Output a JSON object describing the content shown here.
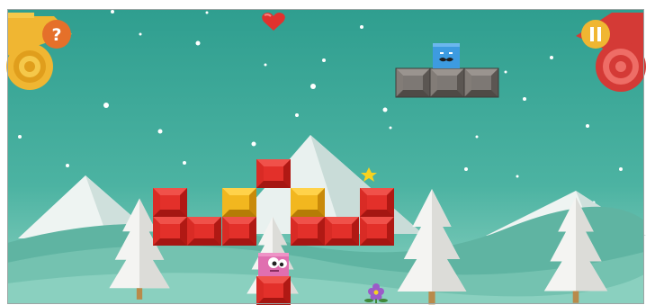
{
  "hud": {
    "help_label": "?",
    "pause_icon": "pause-icon",
    "lives_icon": "heart-icon",
    "lives": 1
  },
  "colors": {
    "sky_top": "#2f9e8f",
    "sky_bottom": "#8fd3c2",
    "block_red": "#e3302a",
    "block_yellow": "#f2b71f",
    "block_gray": "#7d7874",
    "player_blue": "#3d9be0",
    "player_pink": "#e06fb0",
    "help_orange": "#e5702a",
    "help_base": "#f0b632",
    "pause_red": "#d43a36",
    "heart": "#e0322e"
  },
  "icons": [
    "help-icon",
    "pause-icon",
    "heart-icon",
    "flower-icon",
    "star-icon"
  ],
  "characters": [
    {
      "name": "blue-block-character",
      "feature": "mustache"
    },
    {
      "name": "pink-block-character",
      "feature": "googly-eyes"
    }
  ]
}
